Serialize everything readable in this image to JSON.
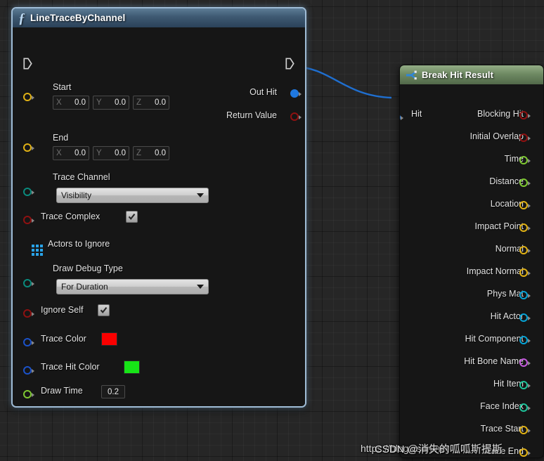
{
  "canvas": {
    "background_color": "#262626",
    "grid_color": "#000000"
  },
  "nodes": {
    "line_trace": {
      "title": "LineTraceByChannel",
      "icon": "function-f-icon",
      "header_color": "#3f5a73",
      "selected": true,
      "exec_in": "exec-input-pin",
      "exec_out": "exec-output-pin",
      "inputs": [
        {
          "label": "Start",
          "pin_color": "#e0b115",
          "type": "vector",
          "fields": [
            {
              "axis": "X",
              "value": "0.0"
            },
            {
              "axis": "Y",
              "value": "0.0"
            },
            {
              "axis": "Z",
              "value": "0.0"
            }
          ]
        },
        {
          "label": "End",
          "pin_color": "#e0b115",
          "type": "vector",
          "fields": [
            {
              "axis": "X",
              "value": "0.0"
            },
            {
              "axis": "Y",
              "value": "0.0"
            },
            {
              "axis": "Z",
              "value": "0.0"
            }
          ]
        },
        {
          "label": "Trace Channel",
          "pin_color": "#0a8a7d",
          "type": "enum",
          "value": "Visibility"
        },
        {
          "label": "Trace Complex",
          "pin_color": "#8e1111",
          "type": "bool",
          "checked": true
        },
        {
          "label": "Actors to Ignore",
          "pin_color": "#29a3e8",
          "type": "array"
        },
        {
          "label": "Draw Debug Type",
          "pin_color": "#0a8a7d",
          "type": "enum",
          "value": "For Duration"
        },
        {
          "label": "Ignore Self",
          "pin_color": "#8e1111",
          "type": "bool",
          "checked": true
        },
        {
          "label": "Trace Color",
          "pin_color": "#1b52c9",
          "type": "color",
          "value": "#fb0000"
        },
        {
          "label": "Trace Hit Color",
          "pin_color": "#1b52c9",
          "type": "color",
          "value": "#17e417"
        },
        {
          "label": "Draw Time",
          "pin_color": "#7ec832",
          "type": "float",
          "value": "0.2"
        }
      ],
      "outputs": [
        {
          "label": "Out Hit",
          "pin_color": "#1f78e0",
          "type": "struct",
          "connected": true
        },
        {
          "label": "Return Value",
          "pin_color": "#8e1111",
          "type": "bool",
          "connected": false
        }
      ],
      "collapse_arrow": "collapse-advanced-pins-arrow"
    },
    "break_hit_result": {
      "title": "Break Hit Result",
      "icon": "break-struct-icon",
      "header_color": "#6f8a63",
      "inputs": [
        {
          "label": "Hit",
          "pin_color": "#1f78e0",
          "type": "struct",
          "connected": true
        }
      ],
      "outputs": [
        {
          "label": "Blocking Hit",
          "pin_color": "#8e1111",
          "type": "bool"
        },
        {
          "label": "Initial Overlap",
          "pin_color": "#8e1111",
          "type": "bool"
        },
        {
          "label": "Time",
          "pin_color": "#7ec832",
          "type": "float"
        },
        {
          "label": "Distance",
          "pin_color": "#7ec832",
          "type": "float"
        },
        {
          "label": "Location",
          "pin_color": "#e0b115",
          "type": "vector"
        },
        {
          "label": "Impact Point",
          "pin_color": "#e0b115",
          "type": "vector"
        },
        {
          "label": "Normal",
          "pin_color": "#e0b115",
          "type": "vector"
        },
        {
          "label": "Impact Normal",
          "pin_color": "#e0b115",
          "type": "vector"
        },
        {
          "label": "Phys Mat",
          "pin_color": "#06a3d6",
          "type": "object"
        },
        {
          "label": "Hit Actor",
          "pin_color": "#06a3d6",
          "type": "object"
        },
        {
          "label": "Hit Component",
          "pin_color": "#06a3d6",
          "type": "object"
        },
        {
          "label": "Hit Bone Name",
          "pin_color": "#c459dd",
          "type": "name"
        },
        {
          "label": "Hit Item",
          "pin_color": "#1ec39a",
          "type": "int"
        },
        {
          "label": "Face Index",
          "pin_color": "#1ec39a",
          "type": "int"
        },
        {
          "label": "Trace Start",
          "pin_color": "#e0b115",
          "type": "vector"
        },
        {
          "label": "Trace End",
          "pin_color": "#e0b115",
          "type": "vector"
        }
      ]
    }
  },
  "wire": {
    "color": "#1f6fd0",
    "from": "Out Hit",
    "to": "Hit"
  },
  "watermark": {
    "url": "https://blog.csdn.net",
    "author": "CSDN @消失的呱呱斯提斯"
  }
}
